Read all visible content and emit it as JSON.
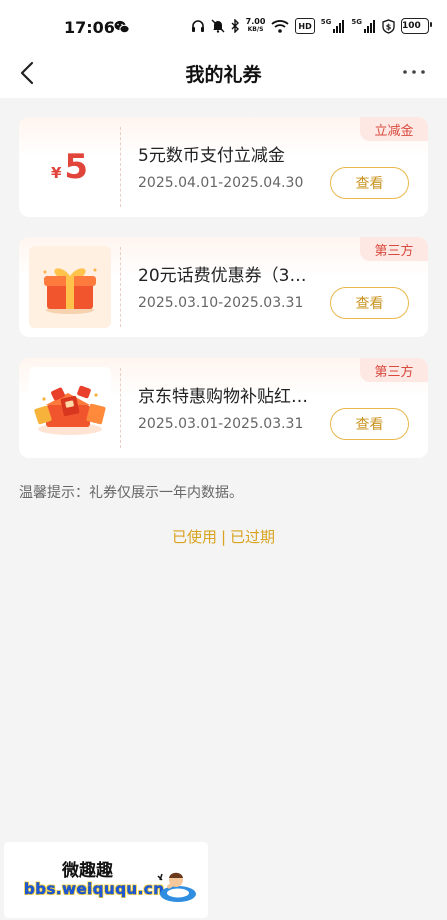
{
  "status_bar": {
    "time": "17:06",
    "net_speed_value": "7.00",
    "net_speed_unit": "KB/S",
    "hd_label": "HD",
    "signal1_label": "5G",
    "signal2_label": "5G",
    "battery": "100",
    "icons": [
      "wechat-icon",
      "headphones-icon",
      "mute-icon",
      "bluetooth-icon",
      "wifi-icon",
      "signal-icon",
      "dollar-shield-icon",
      "battery-icon"
    ]
  },
  "nav": {
    "title": "我的礼券",
    "back_icon": "chevron-left-icon",
    "more_icon": "more-dots-icon"
  },
  "coupons": [
    {
      "amount_symbol": "¥",
      "amount": "5",
      "title": "5元数币支付立减金",
      "date": "2025.04.01-2025.04.30",
      "tag": "立减金",
      "button": "查看"
    },
    {
      "image": "gift-box-icon",
      "title": "20元话费优惠券（3…",
      "date": "2025.03.10-2025.03.31",
      "tag": "第三方",
      "button": "查看"
    },
    {
      "image": "red-envelope-gifts-icon",
      "title": "京东特惠购物补贴红…",
      "date": "2025.03.01-2025.03.31",
      "tag": "第三方",
      "button": "查看"
    }
  ],
  "tip": "温馨提示：礼券仅展示一年内数据。",
  "history": {
    "used": "已使用",
    "separator": "|",
    "expired": "已过期"
  },
  "watermark": {
    "title": "微趣趣",
    "url": "bbs.weiququ.cn"
  },
  "colors": {
    "accent_gold": "#d9a320",
    "tag_red": "#d8493d",
    "amount_red": "#e0443a",
    "background": "#f4f4f4"
  }
}
